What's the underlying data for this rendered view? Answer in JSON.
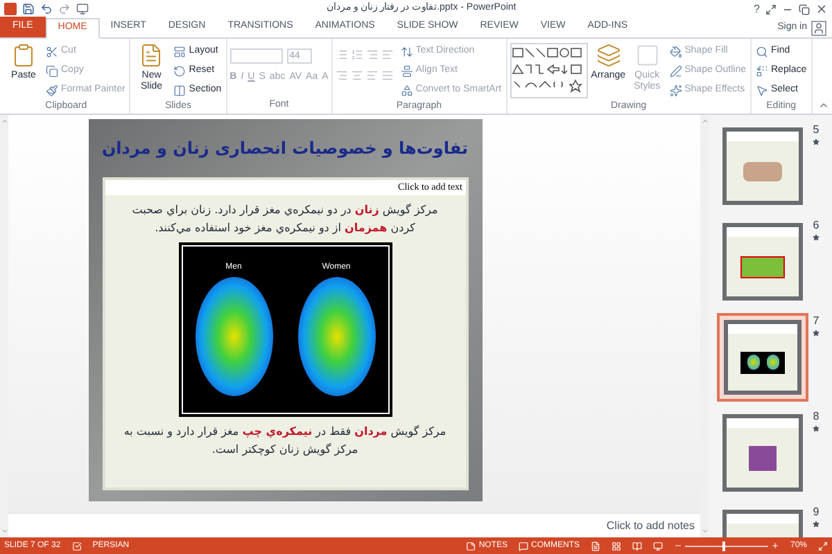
{
  "title_bar": {
    "title": "تفاوت در رفتار زنان و مردان.pptx - PowerPoint",
    "help": "?"
  },
  "tabs": [
    {
      "label": "FILE",
      "kind": "file",
      "selected": false
    },
    {
      "label": "HOME",
      "kind": "tab",
      "selected": true
    },
    {
      "label": "INSERT",
      "kind": "tab",
      "selected": false
    },
    {
      "label": "DESIGN",
      "kind": "tab",
      "selected": false
    },
    {
      "label": "TRANSITIONS",
      "kind": "tab",
      "selected": false
    },
    {
      "label": "ANIMATIONS",
      "kind": "tab",
      "selected": false
    },
    {
      "label": "SLIDE SHOW",
      "kind": "tab",
      "selected": false
    },
    {
      "label": "REVIEW",
      "kind": "tab",
      "selected": false
    },
    {
      "label": "VIEW",
      "kind": "tab",
      "selected": false
    },
    {
      "label": "ADD-INS",
      "kind": "tab",
      "selected": false
    }
  ],
  "account": {
    "label": "Sign in"
  },
  "ribbon": {
    "groups": [
      {
        "label": "Clipboard",
        "kind": "buttons",
        "items": [
          {
            "label": "Paste",
            "kind": "large",
            "disabled": false
          },
          {
            "label": "Cut",
            "kind": "small",
            "disabled": true
          },
          {
            "label": "Copy",
            "kind": "small",
            "disabled": true
          },
          {
            "label": "Format Painter",
            "kind": "small",
            "disabled": true
          }
        ]
      },
      {
        "label": "Slides",
        "kind": "buttons",
        "items": [
          {
            "label": "New Slide",
            "kind": "large",
            "disabled": false
          },
          {
            "label": "Layout",
            "kind": "small",
            "disabled": false
          },
          {
            "label": "Reset",
            "kind": "small",
            "disabled": false
          },
          {
            "label": "Section",
            "kind": "small",
            "disabled": false
          }
        ]
      },
      {
        "label": "Font",
        "kind": "font",
        "items": [
          {
            "value": "44",
            "kind": "field",
            "disabled": true
          },
          {
            "label": "B",
            "kind": "glyph",
            "disabled": true
          },
          {
            "label": "I",
            "kind": "glyph",
            "disabled": true
          },
          {
            "label": "U",
            "kind": "glyph",
            "disabled": true
          },
          {
            "label": "S",
            "kind": "glyph",
            "disabled": true
          },
          {
            "label": "abc",
            "kind": "glyph",
            "disabled": true
          },
          {
            "label": "AV",
            "kind": "glyph",
            "disabled": true
          },
          {
            "label": "Aa",
            "kind": "glyph",
            "disabled": true
          },
          {
            "label": "A",
            "kind": "glyph",
            "disabled": true
          }
        ]
      },
      {
        "label": "Paragraph",
        "kind": "paragraph",
        "items": [
          {
            "label": "Text Direction",
            "kind": "small",
            "disabled": true
          },
          {
            "label": "Align Text",
            "kind": "small",
            "disabled": true
          },
          {
            "label": "Convert to SmartArt",
            "kind": "small",
            "disabled": true
          }
        ]
      },
      {
        "label": "Drawing",
        "kind": "buttons",
        "items": [
          {
            "kind": "gallery",
            "disabled": false
          },
          {
            "label": "Arrange",
            "kind": "large",
            "disabled": false
          },
          {
            "label": "Quick Styles",
            "kind": "large",
            "disabled": true
          },
          {
            "label": "Shape Fill",
            "kind": "small",
            "disabled": true
          },
          {
            "label": "Shape Outline",
            "kind": "small",
            "disabled": true
          },
          {
            "label": "Shape Effects",
            "kind": "small",
            "disabled": true
          }
        ]
      },
      {
        "label": "Editing",
        "kind": "buttons",
        "items": [
          {
            "label": "Find",
            "kind": "small",
            "disabled": false
          },
          {
            "label": "Replace",
            "kind": "small",
            "disabled": false
          },
          {
            "label": "Select",
            "kind": "small",
            "disabled": false
          }
        ]
      }
    ]
  },
  "slide": {
    "title": "تفاوت‌ها و خصوصیات انحصاری زنان و مردان",
    "placeholder": "Click to add text",
    "paragraphs": [
      "مرکز گویش **زنان** در دو نیمکره‌ي مغز قرار دارد. زنان براي صحبت کردن **همزمان** از دو نیمکره‌ي مغز خود استفاده مي‌کنند.",
      "مرکز گویش **مردان** فقط در **نیمکره‌ي چپ** مغز قرار دارد و نسبت به مرکز گویش زنان کوچکتر است."
    ],
    "image_labels": [
      "Men",
      "Women"
    ]
  },
  "notes": {
    "placeholder": "Click to add notes"
  },
  "thumbnails": [
    {
      "number": "5",
      "kind": "photo",
      "selected": false
    },
    {
      "number": "6",
      "kind": "family",
      "selected": false
    },
    {
      "number": "7",
      "kind": "brain",
      "selected": true
    },
    {
      "number": "8",
      "kind": "tissue",
      "selected": false
    },
    {
      "number": "9",
      "kind": "text",
      "selected": false
    }
  ],
  "status_bar": {
    "slide": "SLIDE 7 OF 32",
    "language": "PERSIAN",
    "notes": "NOTES",
    "comments": "COMMENTS",
    "zoom": "70%",
    "level": 0.45
  }
}
